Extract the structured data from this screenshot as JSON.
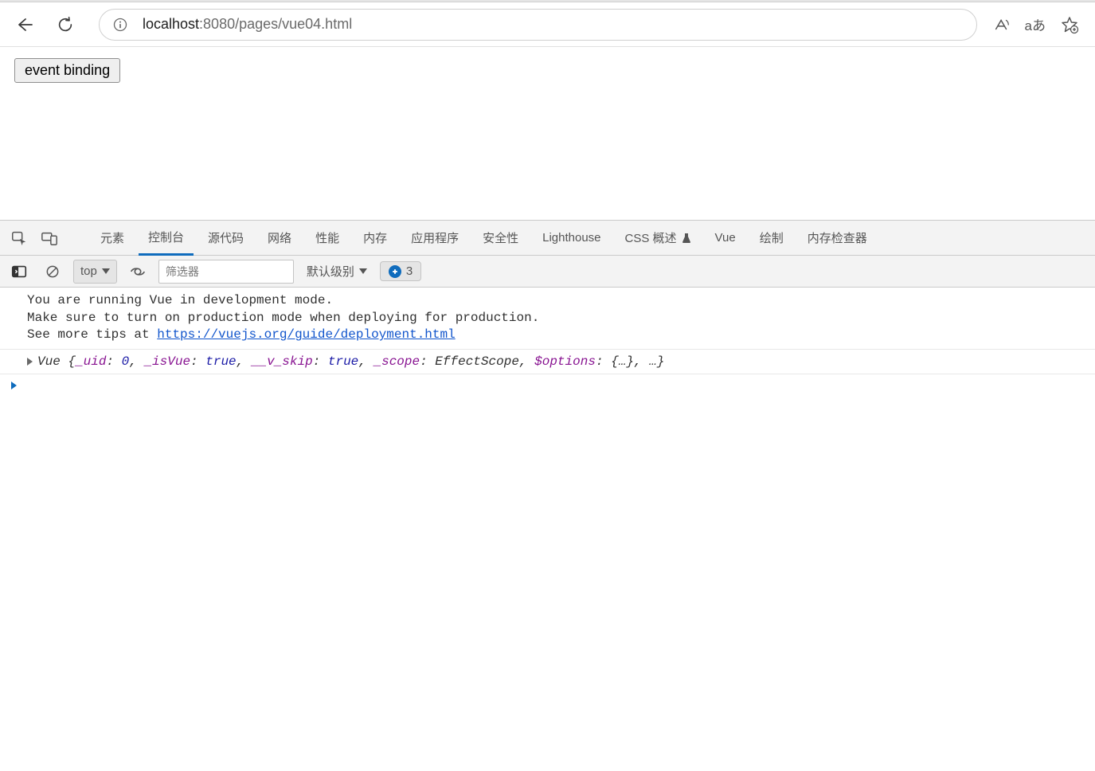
{
  "address": {
    "host": "localhost",
    "port": ":8080",
    "path": "/pages/vue04.html"
  },
  "page": {
    "button_label": "event binding"
  },
  "devtools": {
    "tabs": {
      "elements": "元素",
      "console": "控制台",
      "sources": "源代码",
      "network": "网络",
      "performance": "性能",
      "memory": "内存",
      "application": "应用程序",
      "security": "安全性",
      "lighthouse": "Lighthouse",
      "css_overview": "CSS 概述",
      "vue": "Vue",
      "rendering": "绘制",
      "memory_inspector": "内存检查器"
    },
    "toolbar": {
      "context": "top",
      "filter_placeholder": "筛选器",
      "level": "默认级别",
      "issues_count": "3"
    },
    "messages": {
      "line1": "You are running Vue in development mode.",
      "line2": "Make sure to turn on production mode when deploying for production.",
      "line3_prefix": "See more tips at ",
      "line3_link": "https://vuejs.org/guide/deployment.html"
    },
    "object_preview": {
      "type": "Vue ",
      "open": "{",
      "k1": "_uid",
      "v1": "0",
      "k2": "_isVue",
      "v2": "true",
      "k3": "__v_skip",
      "v3": "true",
      "k4": "_scope",
      "v4": "EffectScope",
      "k5": "$options",
      "v5": "{…}",
      "rest": ", …}"
    }
  }
}
